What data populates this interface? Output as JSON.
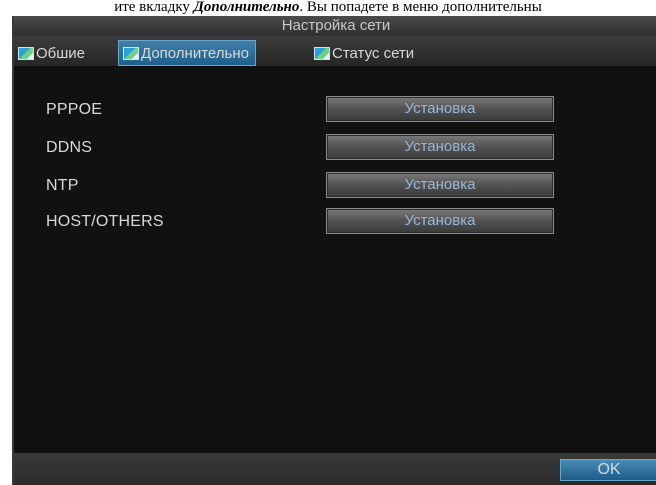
{
  "caption": {
    "before": "ите вкладку ",
    "bold": "Дополнительно",
    "after": ". Вы попадете в меню дополнительны"
  },
  "window": {
    "title": "Настройка сети",
    "tabs": [
      {
        "label": "Обшие",
        "icon": "image-icon",
        "active": false
      },
      {
        "label": "Дополнительно",
        "icon": "image-icon",
        "active": true
      },
      {
        "label": "Статус сети",
        "icon": "image-icon",
        "active": false
      }
    ]
  },
  "rows": [
    {
      "label": "PPPOE",
      "button": "Установка"
    },
    {
      "label": "DDNS",
      "button": "Установка"
    },
    {
      "label": "NTP",
      "button": "Установка"
    },
    {
      "label": "HOST/OTHERS",
      "button": "Установка"
    }
  ],
  "footer": {
    "ok_label": "OK"
  },
  "colors": {
    "window_bg": "#121212",
    "tab_active": "#2f6f9c",
    "text": "#d9d9d9",
    "button_text": "#9bb7d6"
  }
}
